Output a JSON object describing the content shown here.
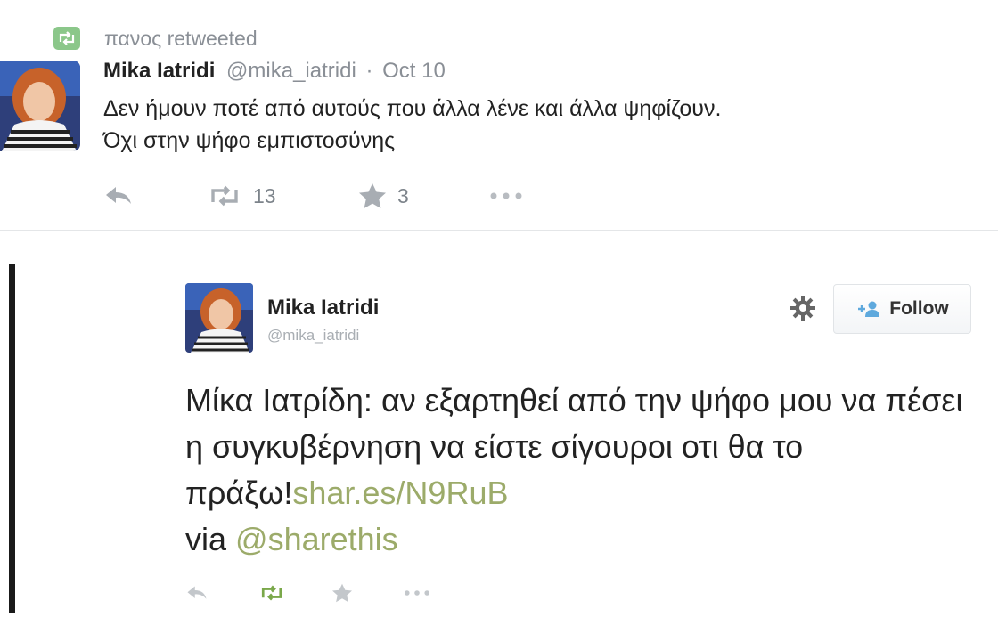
{
  "retweet_context": {
    "label": "πανος retweeted"
  },
  "tweet": {
    "author_name": "Mika Iatridi",
    "author_handle": "@mika_iatridi",
    "separator": "·",
    "date": "Oct 10",
    "text_line1": "Δεν ήμουν ποτέ από αυτούς που άλλα λένε και άλλα ψηφίζουν.",
    "text_line2": "Όχι στην ψήφο εμπιστοσύνης",
    "retweet_count": "13",
    "favorite_count": "3"
  },
  "embedded_tweet": {
    "author_name": "Mika Iatridi",
    "author_handle": "@mika_iatridi",
    "follow_label": "Follow",
    "text_main": "Μίκα Ιατρίδη: αν εξαρτηθεί από την ψήφο μου να πέσει η συγκυβέρνηση  να είστε σίγουροι οτι θα το πράξω!",
    "link_text": "shar.es/N9RuB",
    "via_text": "via ",
    "mention_text": "@sharethis"
  },
  "colors": {
    "link_green": "#9cab6a",
    "retweet_green": "#8bc78a",
    "muted_gray": "#8a8f96"
  },
  "icons": [
    "retweet-icon",
    "reply-icon",
    "favorite-star-icon",
    "more-dots-icon",
    "gear-icon",
    "follow-person-icon"
  ]
}
